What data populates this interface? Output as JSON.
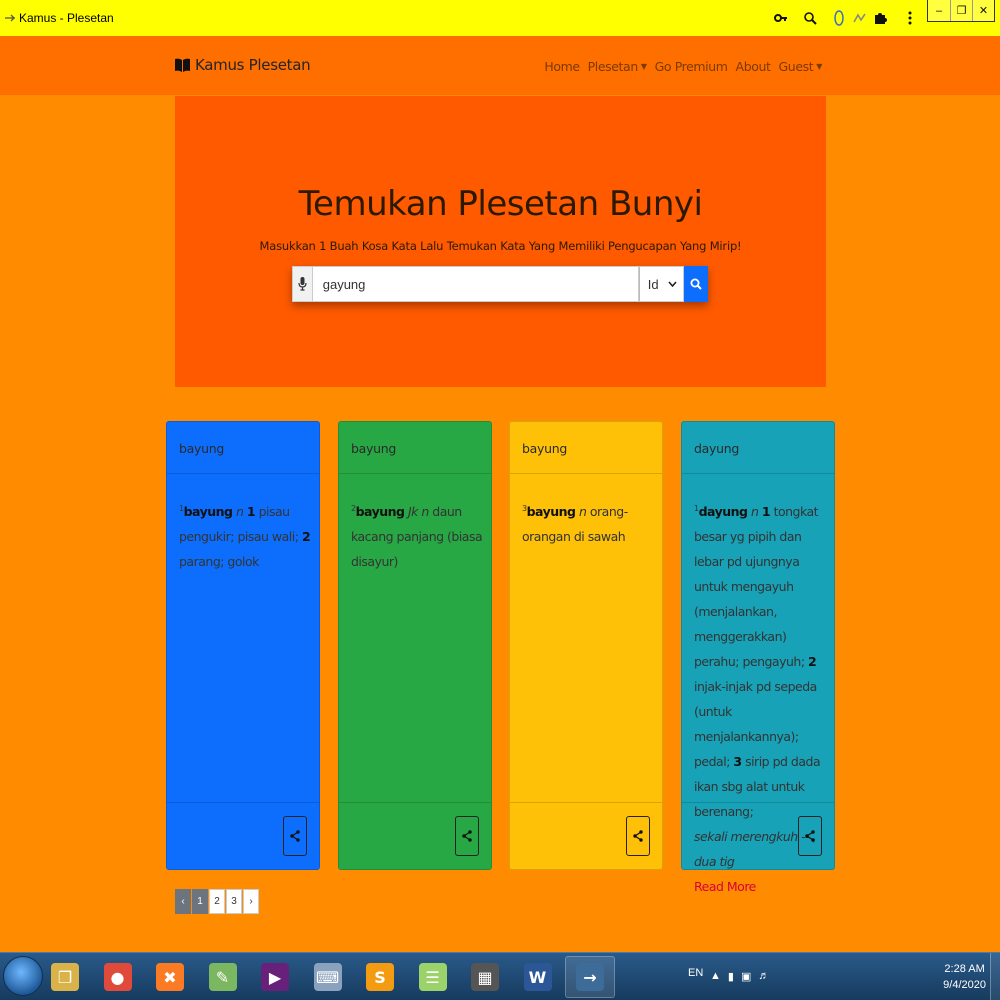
{
  "window": {
    "title": "Kamus - Plesetan",
    "toolbar_icons": [
      "key-icon",
      "zoom-icon",
      "extension-icon",
      "extension-icon",
      "puzzle-icon",
      "more-icon"
    ],
    "controls": {
      "minimize": "–",
      "restore": "❐",
      "close": "✕"
    }
  },
  "navbar": {
    "brand": "Kamus Plesetan",
    "links": [
      {
        "label": "Home"
      },
      {
        "label": "Plesetan",
        "dropdown": true
      },
      {
        "label": "Go Premium"
      },
      {
        "label": "About"
      },
      {
        "label": "Guest",
        "dropdown": true
      }
    ]
  },
  "hero": {
    "title": "Temukan Plesetan Bunyi",
    "subtitle": "Masukkan 1 Buah Kosa Kata Lalu Temukan Kata Yang Memiliki Pengucapan Yang Mirip!",
    "search": {
      "value": "gayung",
      "placeholder": ""
    },
    "language": "Id"
  },
  "cards": [
    {
      "header": "bayung",
      "color": "#0d6efd",
      "sup": "1",
      "word": "bayung",
      "body_html": "<i>n</i> <b>1</b> pisau pengukir; pisau wali; <b>2</b> parang; golok"
    },
    {
      "header": "bayung",
      "color": "#28a745",
      "sup": "2",
      "word": "bayung",
      "body_html": "<i>Jk n</i> daun kacang panjang (biasa disayur)"
    },
    {
      "header": "bayung",
      "color": "#ffc107",
      "sup": "3",
      "word": "bayung",
      "body_html": "<i>n</i> orang-orangan di sawah"
    },
    {
      "header": "dayung",
      "color": "#17a2b8",
      "sup": "1",
      "word": "dayung",
      "body_html": "<i>n</i> <b>1</b> tongkat besar yg pipih dan lebar pd ujungnya untuk mengayuh (menjalankan, menggerakkan) perahu; pengayuh; <b>2</b> injak-injak pd sepeda (untuk menjalankannya); pedal; <b>3</b> sirip pd dada ikan sbg alat untuk berenang;<br><span class='faded'>sekali merengkuh -- , dua tig</span>",
      "read_more": "Read More"
    }
  ],
  "pagination": {
    "prev": "‹",
    "pages": [
      "1",
      "2",
      "3"
    ],
    "active": "1",
    "next": "›"
  },
  "taskbar": {
    "apps": [
      {
        "name": "explorer-icon",
        "color": "#d9b34a",
        "glyph": "❐"
      },
      {
        "name": "chrome-icon",
        "color": "#e04a3a",
        "glyph": "●"
      },
      {
        "name": "xampp-icon",
        "color": "#fb7a24",
        "glyph": "✖"
      },
      {
        "name": "notepadpp-icon",
        "color": "#7bb661",
        "glyph": "✎"
      },
      {
        "name": "visualstudio-icon",
        "color": "#68217a",
        "glyph": "▶"
      },
      {
        "name": "speech-icon",
        "color": "#8aa2bd",
        "glyph": "⌨"
      },
      {
        "name": "sublime-icon",
        "color": "#f39c12",
        "glyph": "S"
      },
      {
        "name": "notes-icon",
        "color": "#9bd36a",
        "glyph": "☰"
      },
      {
        "name": "video-icon",
        "color": "#555555",
        "glyph": "▦"
      },
      {
        "name": "word-icon",
        "color": "#2b5797",
        "glyph": "W"
      },
      {
        "name": "browser-active-icon",
        "color": "#3d6c99",
        "glyph": "→"
      }
    ],
    "lang": "EN",
    "time": "2:28 AM",
    "date": "9/4/2020"
  }
}
